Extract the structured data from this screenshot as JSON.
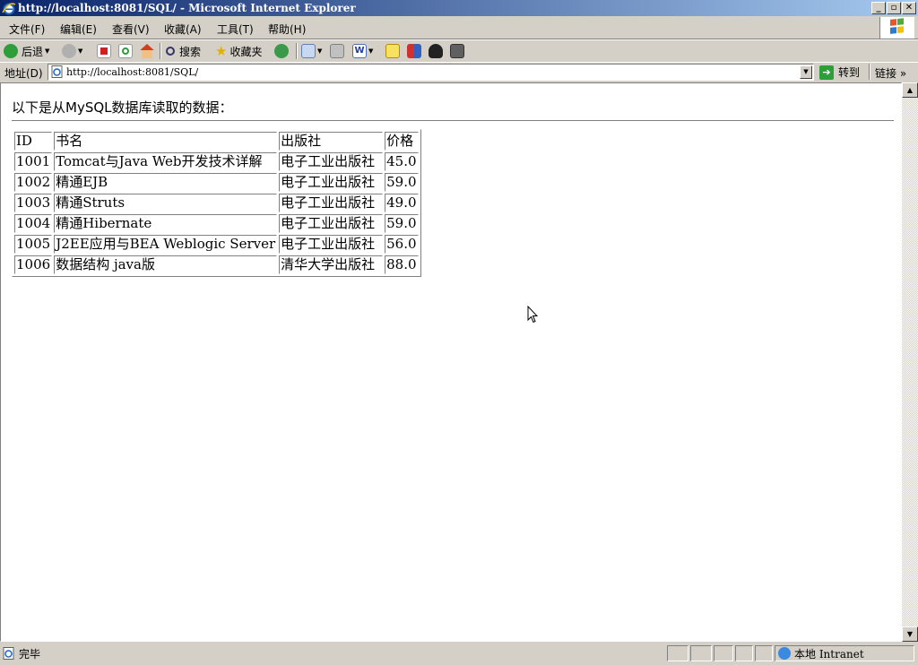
{
  "window": {
    "title": "http://localhost:8081/SQL/ - Microsoft Internet Explorer",
    "minimize_glyph": "_",
    "maximize_glyph": "▫",
    "close_glyph": "✕"
  },
  "menu": [
    "文件(F)",
    "编辑(E)",
    "查看(V)",
    "收藏(A)",
    "工具(T)",
    "帮助(H)"
  ],
  "toolbar": {
    "back_label": "后退",
    "search_label": "搜索",
    "favorites_label": "收藏夹"
  },
  "address": {
    "label": "地址(D)",
    "url": "http://localhost:8081/SQL/",
    "go_label": "转到",
    "links_label": "链接",
    "more_glyph": "»"
  },
  "page": {
    "heading": "以下是从MySQL数据库读取的数据：",
    "table": {
      "headers": [
        "ID",
        "书名",
        "出版社",
        "价格"
      ],
      "rows": [
        [
          "1001",
          "Tomcat与Java Web开发技术详解",
          "电子工业出版社",
          "45.0"
        ],
        [
          "1002",
          "精通EJB",
          "电子工业出版社",
          "59.0"
        ],
        [
          "1003",
          "精通Struts",
          "电子工业出版社",
          "49.0"
        ],
        [
          "1004",
          "精通Hibernate",
          "电子工业出版社",
          "59.0"
        ],
        [
          "1005",
          "J2EE应用与BEA Weblogic Server",
          "电子工业出版社",
          "56.0"
        ],
        [
          "1006",
          "数据结构 java版",
          "清华大学出版社",
          "88.0"
        ]
      ]
    }
  },
  "status": {
    "text": "完毕",
    "zone": "本地 Intranet"
  },
  "colors": {
    "titlebar_start": "#0a246a",
    "titlebar_end": "#a6caf0",
    "chrome": "#d4d0c8"
  }
}
